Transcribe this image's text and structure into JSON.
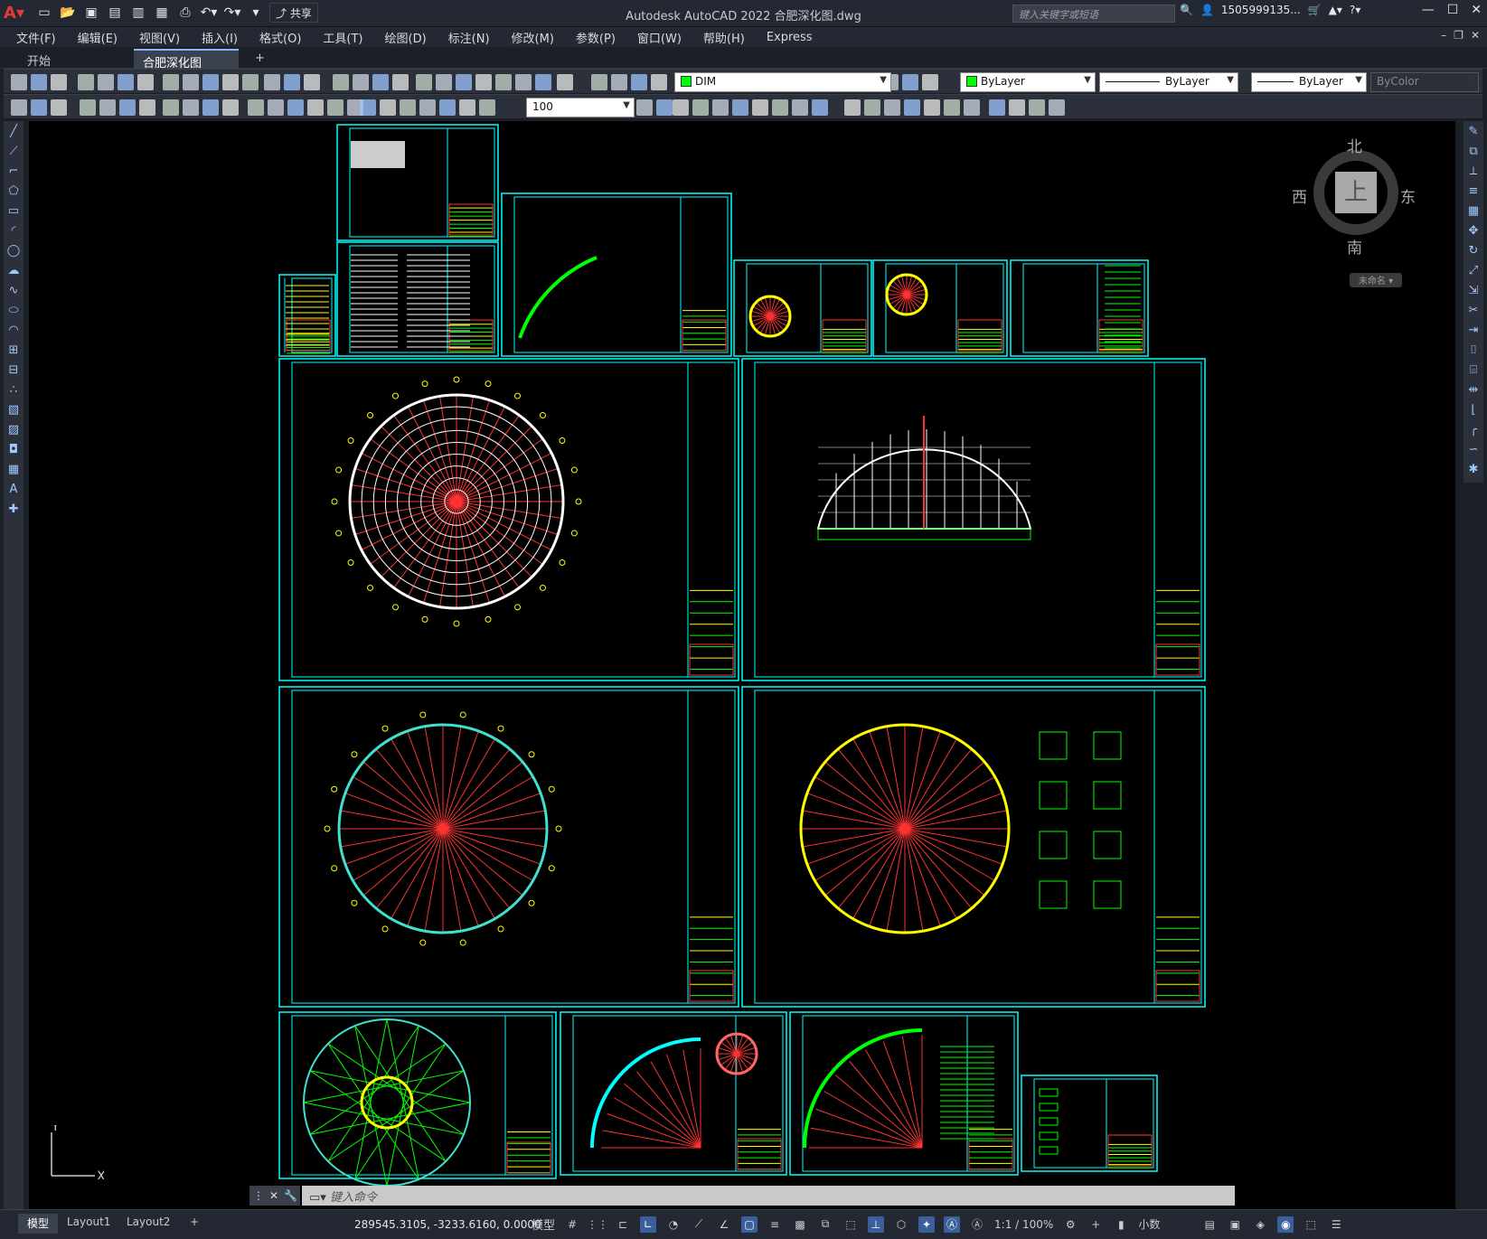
{
  "app": {
    "title": "Autodesk AutoCAD 2022    合肥深化图.dwg",
    "share_label": "共享",
    "search_placeholder": "键入关键字或短语",
    "user": "1505999135...",
    "logo": "A"
  },
  "menu": [
    "文件(F)",
    "编辑(E)",
    "视图(V)",
    "插入(I)",
    "格式(O)",
    "工具(T)",
    "绘图(D)",
    "标注(N)",
    "修改(M)",
    "参数(P)",
    "窗口(W)",
    "帮助(H)",
    "Express"
  ],
  "tabs": {
    "start": "开始",
    "active": "合肥深化图*",
    "add": "+"
  },
  "props": {
    "layer": "DIM",
    "color": "ByLayer",
    "linetype": "ByLayer",
    "lineweight": "ByLayer",
    "plotstyle": "ByColor",
    "dimscale": "100",
    "layer_color": "#00ff00"
  },
  "viewcube": {
    "north": "北",
    "south": "南",
    "east": "东",
    "west": "西",
    "top": "上",
    "wcs": "未命名"
  },
  "ucs": {
    "y": "Y",
    "x": "X"
  },
  "command": {
    "placeholder": "键入命令"
  },
  "status": {
    "layouts": [
      "模型",
      "Layout1",
      "Layout2"
    ],
    "add_layout": "+",
    "coords": "289545.3105, -3233.6160, 0.0000",
    "mode": "模型",
    "scale": "1:1 / 100%",
    "units": "小数"
  }
}
